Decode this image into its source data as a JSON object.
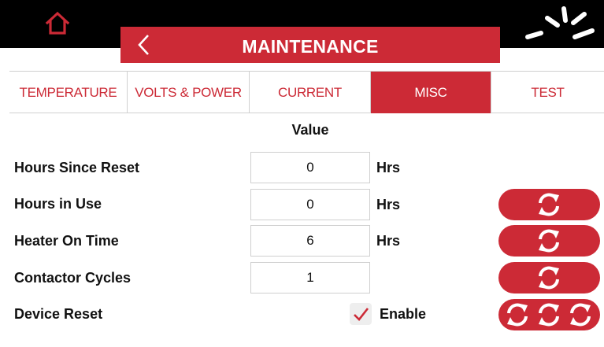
{
  "header": {
    "title": "MAINTENANCE"
  },
  "tabs": [
    {
      "label": "TEMPERATURE",
      "active": false
    },
    {
      "label": "VOLTS & POWER",
      "active": false
    },
    {
      "label": "CURRENT",
      "active": false
    },
    {
      "label": "MISC",
      "active": true
    },
    {
      "label": "TEST",
      "active": false
    }
  ],
  "table": {
    "value_header": "Value",
    "rows": [
      {
        "label": "Hours Since Reset",
        "value": "0",
        "unit": "Hrs"
      },
      {
        "label": "Hours in Use",
        "value": "0",
        "unit": "Hrs"
      },
      {
        "label": "Heater On Time",
        "value": "6",
        "unit": "Hrs"
      },
      {
        "label": "Contactor Cycles",
        "value": "1",
        "unit": ""
      }
    ],
    "device_reset": {
      "label": "Device Reset",
      "enable_label": "Enable",
      "checked": true
    }
  },
  "colors": {
    "accent": "#cc2a36",
    "topbar": "#000000"
  },
  "icons": {
    "home": "home-icon",
    "back": "chevron-left-icon",
    "spinner": "loading-spinner-icon",
    "reset": "refresh-icon",
    "check": "checkmark-icon"
  }
}
